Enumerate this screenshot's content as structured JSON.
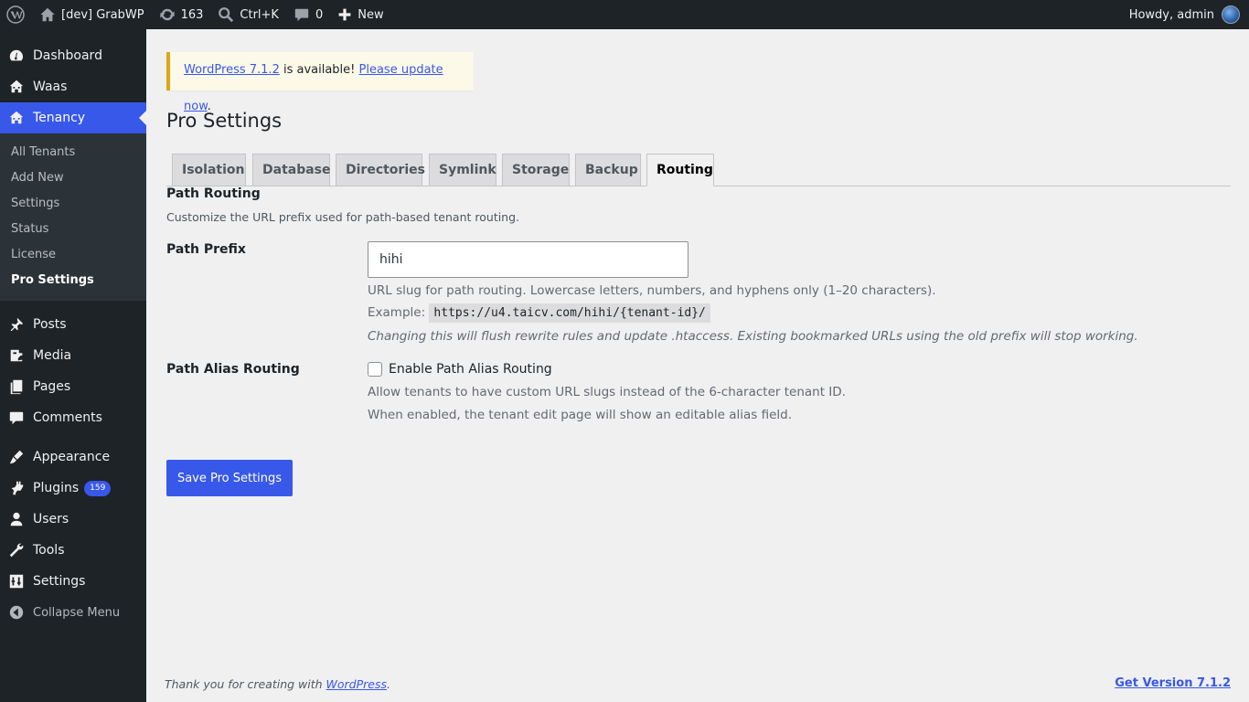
{
  "adminbar": {
    "site_name": "[dev] GrabWP",
    "updates_count": "163",
    "search_shortcut": "Ctrl+K",
    "comments_count": "0",
    "new_label": "New",
    "greeting": "Howdy, admin"
  },
  "sidebar": {
    "items": [
      {
        "label": "Dashboard",
        "icon": "dashboard-icon"
      },
      {
        "label": "Waas",
        "icon": "network-icon"
      },
      {
        "label": "Tenancy",
        "icon": "network-icon",
        "current": true
      },
      {
        "label": "Posts",
        "icon": "pushpin-icon"
      },
      {
        "label": "Media",
        "icon": "media-icon"
      },
      {
        "label": "Pages",
        "icon": "pages-icon"
      },
      {
        "label": "Comments",
        "icon": "comment-icon"
      },
      {
        "label": "Appearance",
        "icon": "brush-icon"
      },
      {
        "label": "Plugins",
        "icon": "plugin-icon",
        "badge": "159"
      },
      {
        "label": "Users",
        "icon": "user-icon"
      },
      {
        "label": "Tools",
        "icon": "wrench-icon"
      },
      {
        "label": "Settings",
        "icon": "sliders-icon"
      },
      {
        "label": "Collapse Menu",
        "icon": "collapse-icon"
      }
    ],
    "submenu": [
      "All Tenants",
      "Add New",
      "Settings",
      "Status",
      "License",
      "Pro Settings"
    ]
  },
  "notice": {
    "link_version": "WordPress 7.1.2",
    "text": " is available! ",
    "link_update": "Please update now",
    "period": "."
  },
  "page_title": "Pro Settings",
  "tabs": [
    "Isolation",
    "Database",
    "Directories",
    "Symlink",
    "Storage",
    "Backup",
    "Routing"
  ],
  "active_tab": "Routing",
  "section": {
    "title": "Path Routing",
    "description": "Customize the URL prefix used for path-based tenant routing."
  },
  "path_prefix": {
    "label": "Path Prefix",
    "value": "hihi",
    "help": "URL slug for path routing. Lowercase letters, numbers, and hyphens only (1–20 characters).",
    "example_label": "Example:",
    "example_code": "https://u4.taicv.com/hihi/{tenant-id}/",
    "warning": "Changing this will flush rewrite rules and update .htaccess. Existing bookmarked URLs using the old prefix will stop working."
  },
  "alias_routing": {
    "label": "Path Alias Routing",
    "checkbox_label": "Enable Path Alias Routing",
    "checked": false,
    "help1": "Allow tenants to have custom URL slugs instead of the 6-character tenant ID.",
    "help2": "When enabled, the tenant edit page will show an editable alias field."
  },
  "save_button": "Save Pro Settings",
  "footer": {
    "thanks_prefix": "Thank you for creating with ",
    "thanks_link": "WordPress",
    "thanks_suffix": ".",
    "version_link": "Get Version 7.1.2"
  },
  "colors": {
    "accent": "#3858e9",
    "adminbar_bg": "#1d2327",
    "notice_border": "#dba617"
  }
}
